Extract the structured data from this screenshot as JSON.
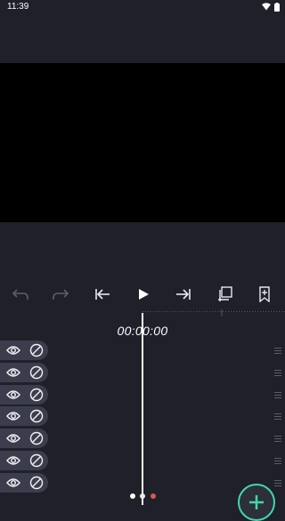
{
  "status": {
    "time": "11:39",
    "icons": [
      "wifi-icon",
      "battery-icon"
    ]
  },
  "toolbar": {
    "buttons": [
      {
        "name": "undo-icon",
        "enabled": false
      },
      {
        "name": "redo-icon",
        "enabled": false
      },
      {
        "name": "skip-to-start-icon",
        "enabled": true
      },
      {
        "name": "play-icon",
        "enabled": true
      },
      {
        "name": "skip-to-end-icon",
        "enabled": true
      },
      {
        "name": "add-layer-icon",
        "enabled": true
      },
      {
        "name": "bookmark-add-icon",
        "enabled": true
      }
    ]
  },
  "timeline": {
    "timecode": "00:00:00",
    "track_count": 7
  },
  "page_indicator": {
    "pages": 3,
    "active_index": 1,
    "colors": [
      "#ffffff",
      "#e9e9ee",
      "#e0554c"
    ]
  },
  "accent_color": "#40d9a8"
}
